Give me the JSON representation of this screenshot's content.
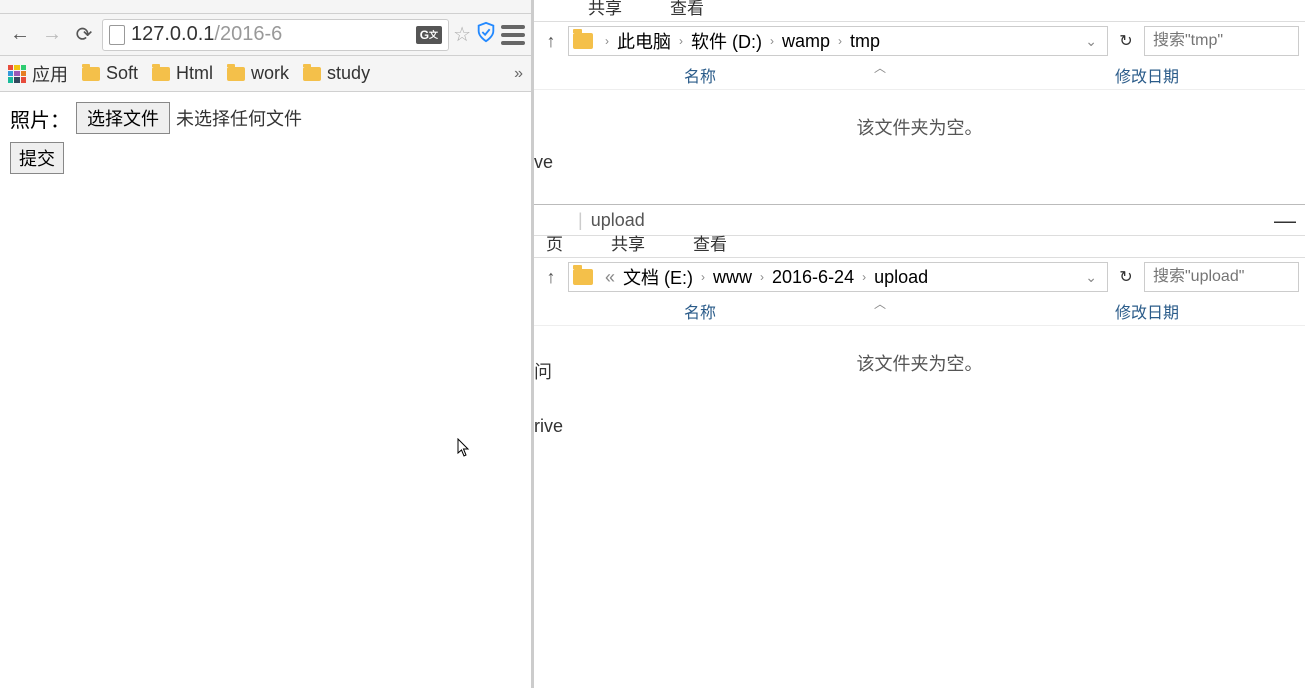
{
  "browser": {
    "url_host": "127.0.0.1",
    "url_path": "/2016-6",
    "bookmarks": {
      "apps": "应用",
      "items": [
        "Soft",
        "Html",
        "work",
        "study"
      ],
      "overflow": "»"
    },
    "page": {
      "label": "照片：",
      "choose_file": "选择文件",
      "no_file": "未选择任何文件",
      "submit": "提交"
    }
  },
  "explorer1": {
    "ribbon": [
      "共享",
      "查看"
    ],
    "breadcrumb": [
      "此电脑",
      "软件 (D:)",
      "wamp",
      "tmp"
    ],
    "search_placeholder": "搜索\"tmp\"",
    "columns": {
      "name": "名称",
      "date": "修改日期"
    },
    "empty": "该文件夹为空。",
    "side_fragment": "ve"
  },
  "explorer2": {
    "title": "upload",
    "ribbon": [
      "页",
      "共享",
      "查看"
    ],
    "breadcrumb_prefix": "«",
    "breadcrumb": [
      "文档 (E:)",
      "www",
      "2016-6-24",
      "upload"
    ],
    "search_placeholder": "搜索\"upload\"",
    "columns": {
      "name": "名称",
      "date": "修改日期"
    },
    "empty": "该文件夹为空。",
    "side_fragment1": "问",
    "side_fragment2": "rive"
  }
}
